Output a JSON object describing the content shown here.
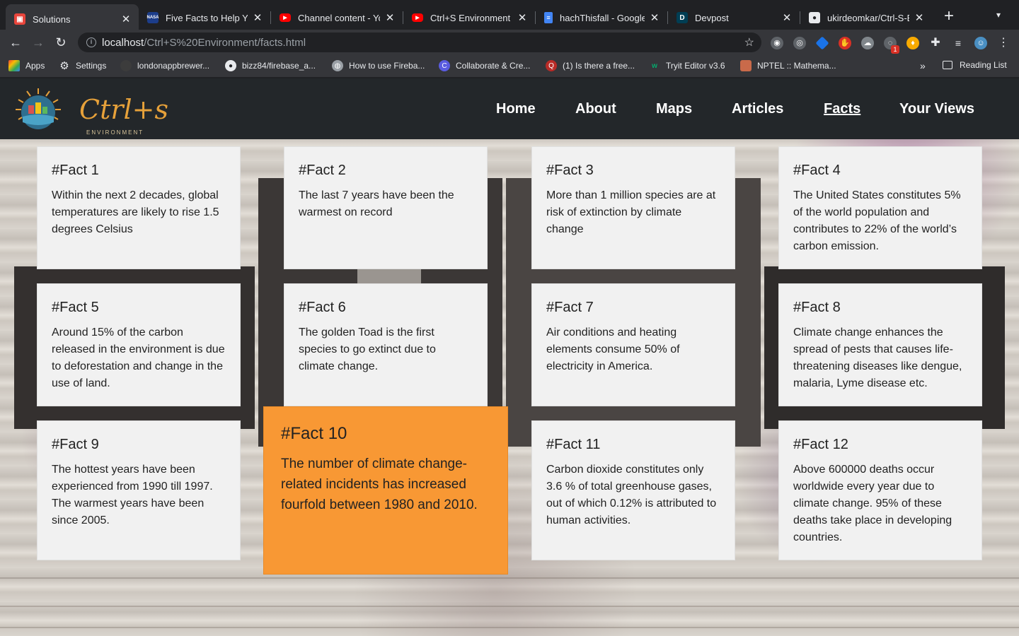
{
  "browser": {
    "tabs": [
      {
        "title": "Solutions",
        "favicon": "solutions-icon",
        "active": true
      },
      {
        "title": "Five Facts to Help You",
        "favicon": "nasa-icon"
      },
      {
        "title": "Channel content - YouTube",
        "favicon": "youtube-icon"
      },
      {
        "title": "Ctrl+S Environment | YouTube",
        "favicon": "youtube-icon"
      },
      {
        "title": "hachThisfall - Google Docs",
        "favicon": "docs-icon"
      },
      {
        "title": "Devpost",
        "favicon": "devpost-icon"
      },
      {
        "title": "ukirdeomkar/Ctrl-S-Environment",
        "favicon": "github-icon"
      }
    ],
    "url_host": "localhost",
    "url_path": "/Ctrl+S%20Environment/facts.html",
    "bookmarks": [
      {
        "label": "Apps",
        "icon": "apps-grid-icon"
      },
      {
        "label": "Settings",
        "icon": "gear-icon"
      },
      {
        "label": "londonappbrewer...",
        "icon": "globe-icon"
      },
      {
        "label": "bizz84/firebase_a...",
        "icon": "github-icon"
      },
      {
        "label": "How to use Fireba...",
        "icon": "globe-icon"
      },
      {
        "label": "Collaborate & Cre...",
        "icon": "canva-icon"
      },
      {
        "label": "(1) Is there a free...",
        "icon": "quora-icon"
      },
      {
        "label": "Tryit Editor v3.6",
        "icon": "w3-icon"
      },
      {
        "label": "NPTEL :: Mathema...",
        "icon": "nptel-icon"
      }
    ],
    "reading_list": "Reading List",
    "extension_badge": "1"
  },
  "site": {
    "logo_text": "Ctrl+s",
    "logo_sub": "ENVIRONMENT",
    "nav": [
      "Home",
      "About",
      "Maps",
      "Articles",
      "Facts",
      "Your Views"
    ],
    "active_nav": "Facts"
  },
  "facts": [
    {
      "title": "#Fact 1",
      "text": "Within the next 2 decades, global temperatures are likely to rise 1.5 degrees Celsius"
    },
    {
      "title": "#Fact 2",
      "text": "The last 7 years have been the warmest on record"
    },
    {
      "title": "#Fact 3",
      "text": "More than 1 million species are at risk of extinction by climate change"
    },
    {
      "title": "#Fact 4",
      "text": "The United States constitutes 5% of the world population and contributes to 22% of the world’s carbon emission."
    },
    {
      "title": "#Fact 5",
      "text": "Around 15% of the carbon released in the environment is due to deforestation and change in the use of land."
    },
    {
      "title": "#Fact 6",
      "text": "The golden Toad is the first species to go extinct due to climate change."
    },
    {
      "title": "#Fact 7",
      "text": "Air conditions and heating elements consume 50% of electricity in America."
    },
    {
      "title": "#Fact 8",
      "text": "Climate change enhances the spread of pests that causes life-threatening diseases like dengue, malaria, Lyme disease etc."
    },
    {
      "title": "#Fact 9",
      "text": "The hottest years have been experienced from 1990 till 1997. The warmest years have been since 2005."
    },
    {
      "title": "#Fact 10",
      "text": "The number of climate change-related incidents has increased fourfold between 1980 and 2010."
    },
    {
      "title": "#Fact 11",
      "text": "Carbon dioxide constitutes only 3.6 % of total greenhouse gases, out of which 0.12% is attributed to human activities."
    },
    {
      "title": "#Fact 12",
      "text": "Above 600000 deaths occur worldwide every year due to climate change. 95% of these deaths take place in developing countries."
    }
  ],
  "colors": {
    "highlight_card": "#f89834",
    "card": "#f1f1f1",
    "navbar": "#23272a",
    "logo": "#e6a13a"
  }
}
